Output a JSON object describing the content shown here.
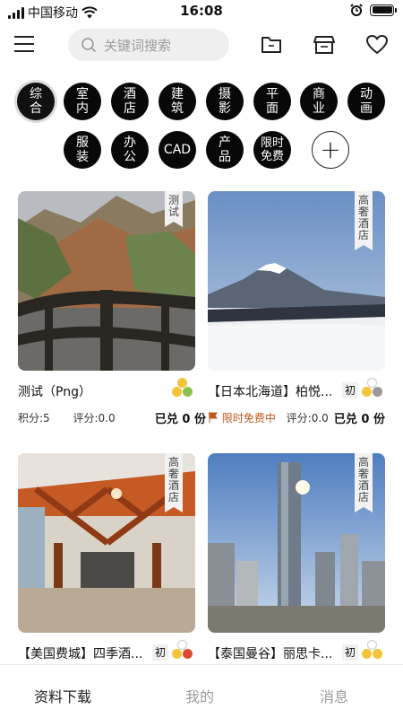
{
  "status_bar": {
    "carrier": "中国移动",
    "time": "16:08"
  },
  "search": {
    "placeholder": "关键词搜索"
  },
  "icons": {
    "menu": "menu-icon",
    "folder": "folder-icon",
    "store": "store-icon",
    "favorite": "heart-icon"
  },
  "categories": [
    "综合",
    "室内",
    "酒店",
    "建筑",
    "摄影",
    "平面",
    "商业",
    "动画",
    "服装",
    "办公",
    "CAD",
    "产品",
    "限时免费",
    "+"
  ],
  "cards": [
    {
      "title": "测试（Png）",
      "tag": "测试",
      "meta_score": "积分:5",
      "meta_rating": "评分:0.0",
      "redeemed": "已兑 0 份"
    },
    {
      "title": "【日本北海道】柏悦...",
      "badge": "初",
      "tag": "高奢酒店",
      "free": "限时免费中",
      "meta_rating": "评分:0.0",
      "redeemed": "已兑 0 份"
    },
    {
      "title": "【美国费城】四季酒...",
      "badge": "初",
      "tag": "高奢酒店"
    },
    {
      "title": "【泰国曼谷】丽思卡...",
      "badge": "初",
      "tag": "高奢酒店"
    }
  ],
  "tabs": [
    "资料下载",
    "我的",
    "消息"
  ],
  "colors": {
    "accent": "#111111",
    "free_text": "#c0581f",
    "dot_yellow": "#f3c43a",
    "dot_green": "#8bc34a",
    "dot_red": "#e04a2f"
  }
}
